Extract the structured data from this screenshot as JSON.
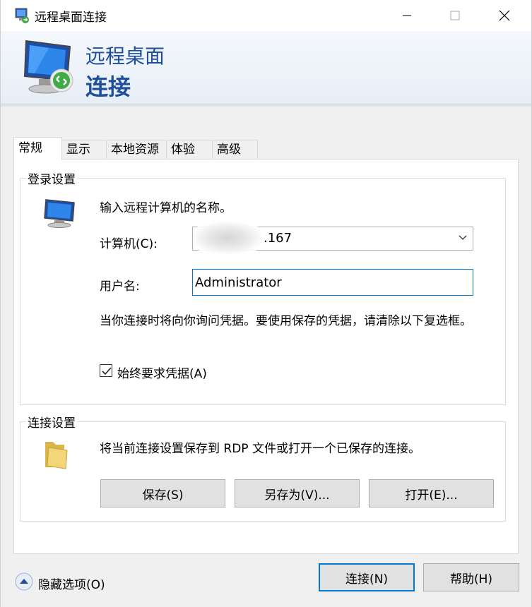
{
  "window": {
    "title": "远程桌面连接",
    "controls": {
      "minimize": "minimize",
      "maximize": "maximize",
      "close": "close"
    }
  },
  "banner": {
    "line1": "远程桌面",
    "line2": "连接"
  },
  "tabs": [
    {
      "label": "常规",
      "active": true
    },
    {
      "label": "显示",
      "active": false
    },
    {
      "label": "本地资源",
      "active": false
    },
    {
      "label": "体验",
      "active": false
    },
    {
      "label": "高级",
      "active": false
    }
  ],
  "login": {
    "group_label": "登录设置",
    "instruction": "输入远程计算机的名称。",
    "computer_label": "计算机(C):",
    "computer_value": ".167",
    "username_label": "用户名:",
    "username_value": "Administrator",
    "note": "当你连接时将向你询问凭据。要使用保存的凭据，请清除以下复选框。",
    "checkbox_label": "始终要求凭据(A)",
    "checkbox_checked": true
  },
  "connection": {
    "group_label": "连接设置",
    "description": "将当前连接设置保存到 RDP 文件或打开一个已保存的连接。",
    "save_label": "保存(S)",
    "save_as_label": "另存为(V)...",
    "open_label": "打开(E)..."
  },
  "footer": {
    "hide_options_label": "隐藏选项(O)",
    "connect_label": "连接(N)",
    "help_label": "帮助(H)"
  },
  "colors": {
    "accent": "#0078d7",
    "banner_text": "#1f4e9c",
    "button_bg": "#e1e1e1"
  }
}
